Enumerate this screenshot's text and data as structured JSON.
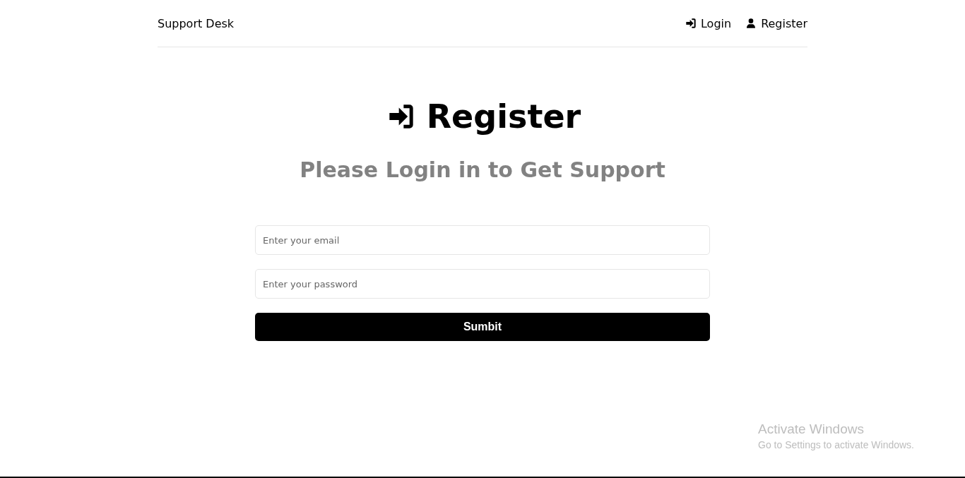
{
  "header": {
    "logo": "Support Desk",
    "nav": [
      {
        "label": "Login",
        "kind": "login"
      },
      {
        "label": "Register",
        "kind": "user"
      }
    ]
  },
  "heading": {
    "title": "Register",
    "kind": "login",
    "subtitle": "Please Login in to Get Support"
  },
  "form": {
    "fields": [
      {
        "placeholder": "Enter your email"
      },
      {
        "placeholder": "Enter your password"
      }
    ],
    "submit": "Sumbit"
  },
  "os_overlay": {
    "title": "Activate Windows",
    "message": "Go to Settings to activate Windows."
  }
}
